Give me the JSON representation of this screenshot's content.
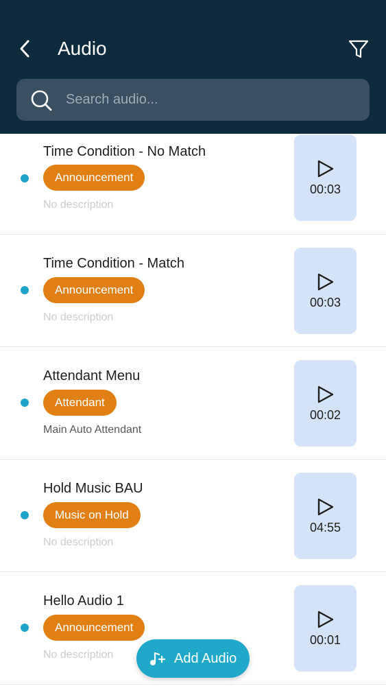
{
  "header": {
    "title": "Audio",
    "back_icon": "chevron-left-icon",
    "filter_icon": "filter-icon"
  },
  "search": {
    "placeholder": "Search audio...",
    "value": "",
    "icon": "search-icon"
  },
  "items": [
    {
      "name": "Time Condition - No Match",
      "tag": "Announcement",
      "description": "No description",
      "duration": "00:03"
    },
    {
      "name": "Time Condition - Match",
      "tag": "Announcement",
      "description": "No description",
      "duration": "00:03"
    },
    {
      "name": "Attendant Menu",
      "tag": "Attendant",
      "description": "Main Auto Attendant",
      "duration": "00:02"
    },
    {
      "name": "Hold Music BAU",
      "tag": "Music on Hold",
      "description": "No description",
      "duration": "04:55"
    },
    {
      "name": "Hello Audio 1",
      "tag": "Announcement",
      "description": "No description",
      "duration": "00:01"
    }
  ],
  "fab": {
    "label": "Add Audio",
    "icon": "add-music-icon"
  },
  "colors": {
    "header_bg": "#0e2a3d",
    "tag_bg": "#e07f13",
    "play_bg": "#d4e3f8",
    "accent": "#1fa8c7"
  }
}
